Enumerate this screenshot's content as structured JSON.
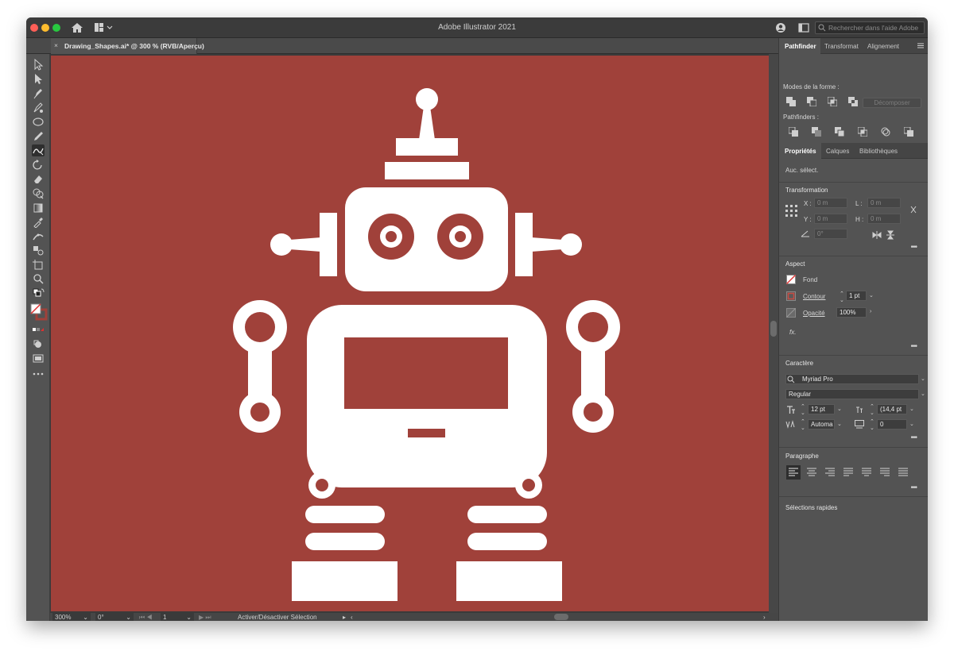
{
  "app": {
    "title": "Adobe Illustrator 2021"
  },
  "help": {
    "placeholder": "Rechercher dans l'aide Adobe"
  },
  "document": {
    "tab_label": "Drawing_Shapes.ai* @ 300 % (RVB/Aperçu)",
    "close_glyph": "×"
  },
  "tools": [
    "selection-tool",
    "direct-selection-tool",
    "pen-tool",
    "curvature-tool",
    "ellipse-tool",
    "pencil-tool",
    "shaper-tool",
    "rotate-tool",
    "eraser-tool",
    "shape-builder-tool",
    "gradient-tool",
    "eyedropper-tool",
    "width-tool",
    "blend-tool",
    "artboard-tool",
    "zoom-tool"
  ],
  "statusbar": {
    "zoom": "300%",
    "rotation": "0°",
    "artboard_number": "1",
    "toggle_label": "Activer/Désactiver Sélection"
  },
  "pathfinder_panel": {
    "tabs": [
      "Pathfinder",
      "Transformat",
      "Alignement"
    ],
    "shape_modes_label": "Modes de la forme :",
    "expand_button": "Décomposer",
    "pathfinders_label": "Pathfinders :"
  },
  "properties_panel": {
    "tabs": [
      "Propriétés",
      "Calques",
      "Bibliothèques"
    ],
    "no_selection": "Auc. sélect.",
    "transform": {
      "title": "Transformation",
      "x_label": "X :",
      "x_value": "0 m",
      "y_label": "Y :",
      "y_value": "0 m",
      "w_label": "L :",
      "w_value": "0 m",
      "h_label": "H :",
      "h_value": "0 m",
      "angle_value": "0°"
    },
    "appearance": {
      "title": "Aspect",
      "fill_label": "Fond",
      "stroke_label": "Contour",
      "stroke_value": "1 pt",
      "opacity_label": "Opacité",
      "opacity_value": "100%",
      "fx_label": "fx."
    },
    "character": {
      "title": "Caractère",
      "font_family": "Myriad Pro",
      "font_style": "Regular",
      "font_size": "12 pt",
      "leading": "(14,4 pt",
      "kerning": "Automa",
      "tracking": "0"
    },
    "paragraph": {
      "title": "Paragraphe"
    },
    "quick_actions": {
      "title": "Sélections rapides"
    },
    "more": "•••"
  },
  "colors": {
    "artboard": "#a0413a",
    "robot": "#ffffff",
    "chrome": "#535353"
  }
}
